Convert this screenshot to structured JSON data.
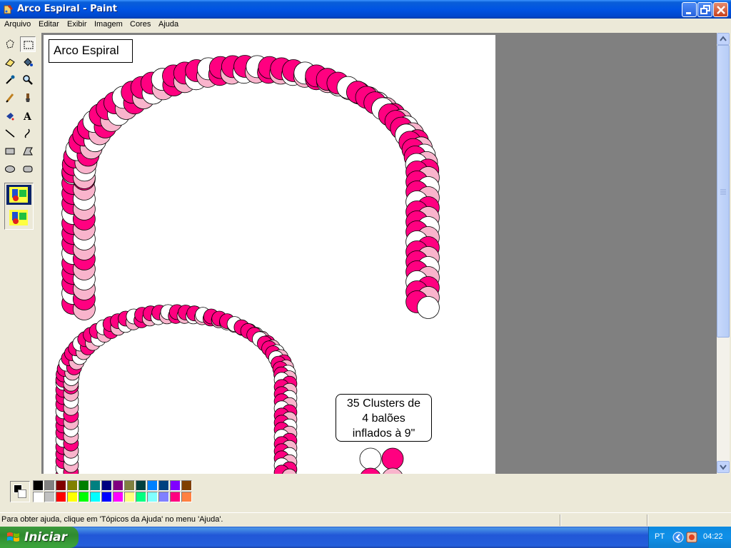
{
  "window": {
    "title": "Arco Espiral - Paint"
  },
  "menu": {
    "items": [
      "Arquivo",
      "Editar",
      "Exibir",
      "Imagem",
      "Cores",
      "Ajuda"
    ]
  },
  "canvas": {
    "caption": "Arco Espiral",
    "note_line1": "35 Clusters de",
    "note_line2": "4 balões",
    "note_line3": "inflados à 9\"",
    "balloon_colors": {
      "magenta": "#ff0080",
      "pink": "#f9b4cc",
      "white": "#ffffff"
    }
  },
  "toolbox": {
    "tools": [
      "free-select",
      "rect-select",
      "eraser",
      "fill-bucket",
      "color-picker",
      "magnifier",
      "pencil",
      "brush",
      "airbrush",
      "text",
      "line",
      "curve",
      "rectangle",
      "polygon",
      "ellipse",
      "rounded-rectangle"
    ],
    "selected": "rect-select"
  },
  "palette": {
    "foreground": "#000000",
    "background": "#ffffff",
    "row1": [
      "#000000",
      "#808080",
      "#800000",
      "#808000",
      "#008000",
      "#008080",
      "#000080",
      "#800080",
      "#808040",
      "#004040",
      "#0080ff",
      "#004080",
      "#8000ff",
      "#804000"
    ],
    "row2": [
      "#ffffff",
      "#c0c0c0",
      "#ff0000",
      "#ffff00",
      "#00ff00",
      "#00ffff",
      "#0000ff",
      "#ff00ff",
      "#ffff80",
      "#00ff80",
      "#80ffff",
      "#8080ff",
      "#ff0080",
      "#ff8040"
    ]
  },
  "status": {
    "help_text": "Para obter ajuda, clique em 'Tópicos da Ajuda' no menu 'Ajuda'."
  },
  "taskbar": {
    "start_label": "Iniciar",
    "language": "PT",
    "clock": "04:22"
  }
}
